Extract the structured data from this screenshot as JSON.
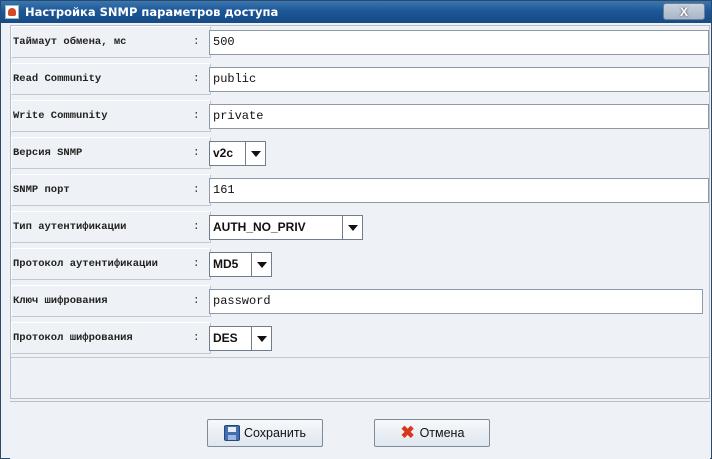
{
  "window": {
    "title": "Настройка SNMP параметров доступа",
    "close_label": "X"
  },
  "form": {
    "fields": [
      {
        "label": "Таймаут обмена, мс",
        "colon": ":",
        "value": "500",
        "type": "text"
      },
      {
        "label": "Read Community",
        "colon": ":",
        "value": "public",
        "type": "text"
      },
      {
        "label": "Write Community",
        "colon": ":",
        "value": "private",
        "type": "text"
      },
      {
        "label": "Версия SNMP",
        "colon": ":",
        "value": "v2c",
        "type": "select"
      },
      {
        "label": "SNMP порт",
        "colon": ":",
        "value": "161",
        "type": "text"
      },
      {
        "label": "Тип аутентификации",
        "colon": ":",
        "value": "AUTH_NO_PRIV",
        "type": "select"
      },
      {
        "label": "Протокол аутентификации",
        "colon": ":",
        "value": "MD5",
        "type": "select"
      },
      {
        "label": "Ключ шифрования",
        "colon": ":",
        "value": "password",
        "type": "text"
      },
      {
        "label": "Протокол шифрования",
        "colon": ":",
        "value": "DES",
        "type": "select"
      }
    ]
  },
  "buttons": {
    "save_label": "Сохранить",
    "save_icon": "floppy-disk-icon",
    "cancel_label": "Отмена",
    "cancel_icon": "red-x-icon",
    "cancel_glyph": "✖"
  }
}
